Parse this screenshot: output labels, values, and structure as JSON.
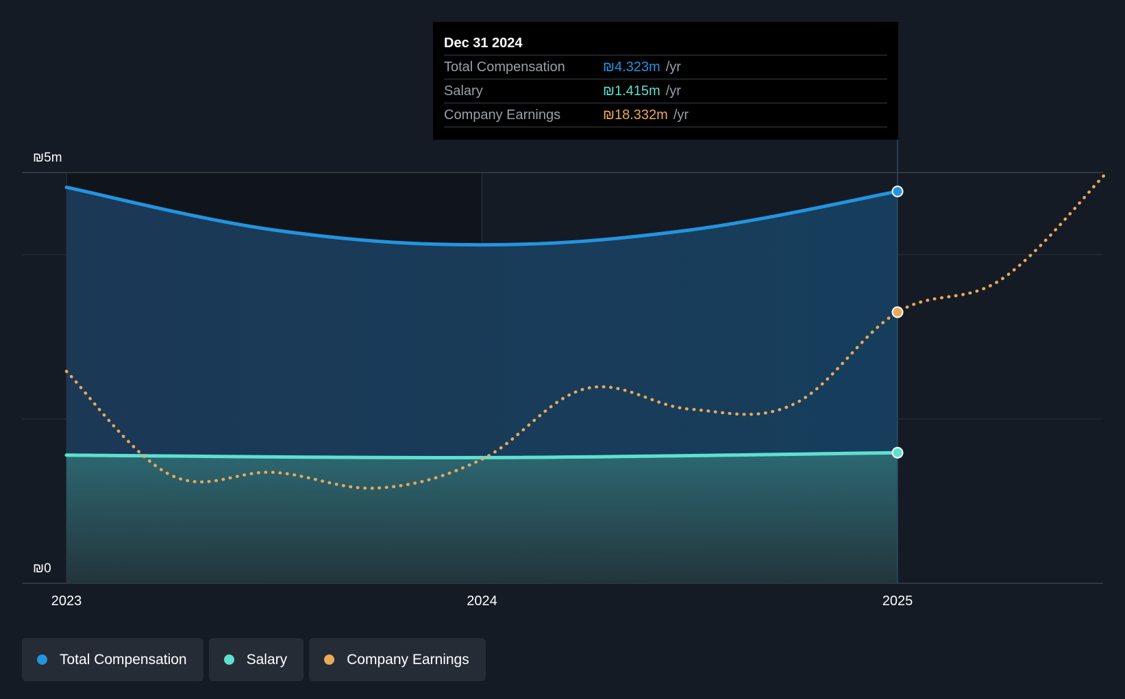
{
  "chart_data": {
    "type": "area",
    "y_axis": {
      "min": 0,
      "max": 5,
      "top_label": "₪5m",
      "bottom_label": "₪0",
      "unit": "₪m"
    },
    "x_axis": {
      "ticks": [
        "2023",
        "2024",
        "2025"
      ],
      "range": [
        2023.0,
        2025.5
      ]
    },
    "grid": true,
    "legend_position": "bottom-left",
    "series": [
      {
        "name": "Total Compensation",
        "color": "#2394df",
        "style": "solid-area",
        "points": [
          {
            "x": 2023.0,
            "y": 4.82
          },
          {
            "x": 2023.5,
            "y": 4.3
          },
          {
            "x": 2024.0,
            "y": 4.12
          },
          {
            "x": 2024.5,
            "y": 4.3
          },
          {
            "x": 2025.0,
            "y": 4.77
          }
        ]
      },
      {
        "name": "Salary",
        "color": "#5ee0d0",
        "style": "solid-area",
        "points": [
          {
            "x": 2023.0,
            "y": 1.56
          },
          {
            "x": 2024.0,
            "y": 1.53
          },
          {
            "x": 2025.0,
            "y": 1.59
          }
        ]
      },
      {
        "name": "Company Earnings",
        "color": "#e9a95a",
        "style": "dotted",
        "points": [
          {
            "x": 2023.0,
            "y": 2.58
          },
          {
            "x": 2023.25,
            "y": 1.32
          },
          {
            "x": 2023.5,
            "y": 1.35
          },
          {
            "x": 2023.75,
            "y": 1.16
          },
          {
            "x": 2024.0,
            "y": 1.51
          },
          {
            "x": 2024.25,
            "y": 2.37
          },
          {
            "x": 2024.5,
            "y": 2.12
          },
          {
            "x": 2024.75,
            "y": 2.18
          },
          {
            "x": 2025.0,
            "y": 3.3
          },
          {
            "x": 2025.25,
            "y": 3.7
          },
          {
            "x": 2025.5,
            "y": 4.98
          }
        ]
      }
    ]
  },
  "tooltip": {
    "date": "Dec 31 2024",
    "rows": [
      {
        "label": "Total Compensation",
        "value": "₪4.323m",
        "unit": "/yr",
        "color": "#2394df"
      },
      {
        "label": "Salary",
        "value": "₪1.415m",
        "unit": "/yr",
        "color": "#5ee0d0"
      },
      {
        "label": "Company Earnings",
        "value": "₪18.332m",
        "unit": "/yr",
        "color": "#e9a95a"
      }
    ]
  },
  "legend": [
    {
      "label": "Total Compensation",
      "color": "#2394df"
    },
    {
      "label": "Salary",
      "color": "#5ee0d0"
    },
    {
      "label": "Company Earnings",
      "color": "#e9a95a"
    }
  ]
}
